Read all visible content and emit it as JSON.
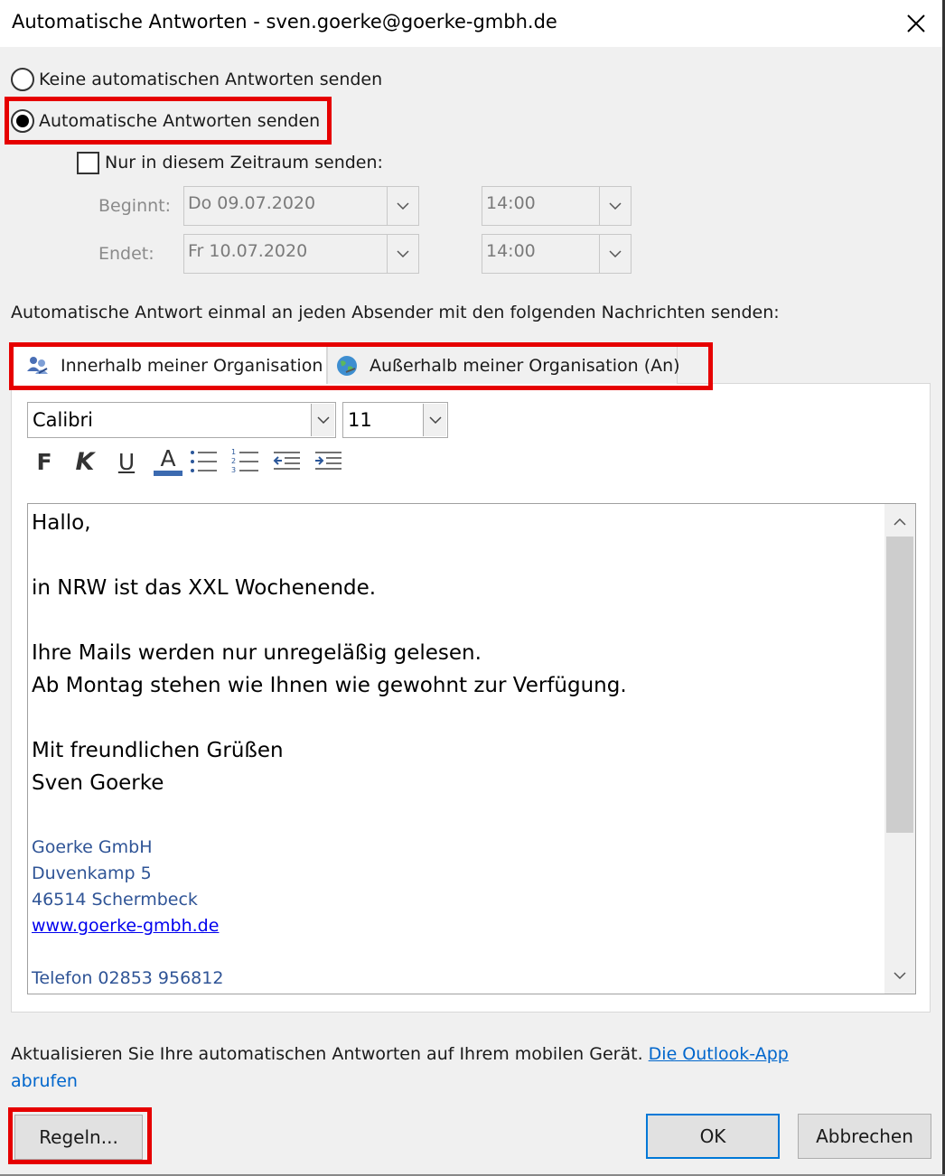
{
  "window": {
    "title": "Automatische Antworten - sven.goerke@goerke-gmbh.de"
  },
  "options": {
    "no_reply_label": "Keine automatischen Antworten senden",
    "send_reply_label": "Automatische Antworten senden",
    "selected": "send_reply",
    "timeframe_label": "Nur in diesem Zeitraum senden:",
    "timeframe_checked": false
  },
  "schedule": {
    "start_label": "Beginnt:",
    "start_date": "Do 09.07.2020",
    "start_time": "14:00",
    "end_label": "Endet:",
    "end_date": "Fr 10.07.2020",
    "end_time": "14:00"
  },
  "instruction": "Automatische Antwort einmal an jeden Absender mit den folgenden Nachrichten senden:",
  "tabs": [
    {
      "label": "Innerhalb meiner Organisation",
      "icon": "people-icon",
      "active": true
    },
    {
      "label": "Außerhalb meiner Organisation (An)",
      "icon": "globe-icon",
      "active": false
    }
  ],
  "formatting": {
    "font": "Calibri",
    "size": "11",
    "bold_label": "F",
    "italic_label": "K",
    "underline_label": "U",
    "font_color_label": "A",
    "font_color": "#3b6ab0"
  },
  "message": {
    "lines": [
      "Hallo,",
      "in NRW ist das XXL Wochenende.",
      "Ihre Mails werden nur unregeläßig gelesen.",
      "Ab Montag stehen wie Ihnen wie gewohnt zur Verfügung.",
      "Mit freundlichen Grüßen",
      "Sven Goerke"
    ],
    "signature": {
      "company": "Goerke GmbH",
      "street": "Duvenkamp 5",
      "city": "46514 Schermbeck",
      "website": "www.goerke-gmbh.de",
      "phone": "Telefon 02853 956812"
    }
  },
  "footer": {
    "text": "Aktualisieren Sie Ihre automatischen Antworten auf Ihrem mobilen Gerät. ",
    "link_part1": "Die Outlook-App",
    "link_part2": "abrufen"
  },
  "buttons": {
    "rules": "Regeln...",
    "ok": "OK",
    "cancel": "Abbrechen"
  },
  "colors": {
    "highlight": "#e60000",
    "signature": "#2f5496",
    "link": "#0066cc",
    "ok_border": "#0078d7"
  }
}
